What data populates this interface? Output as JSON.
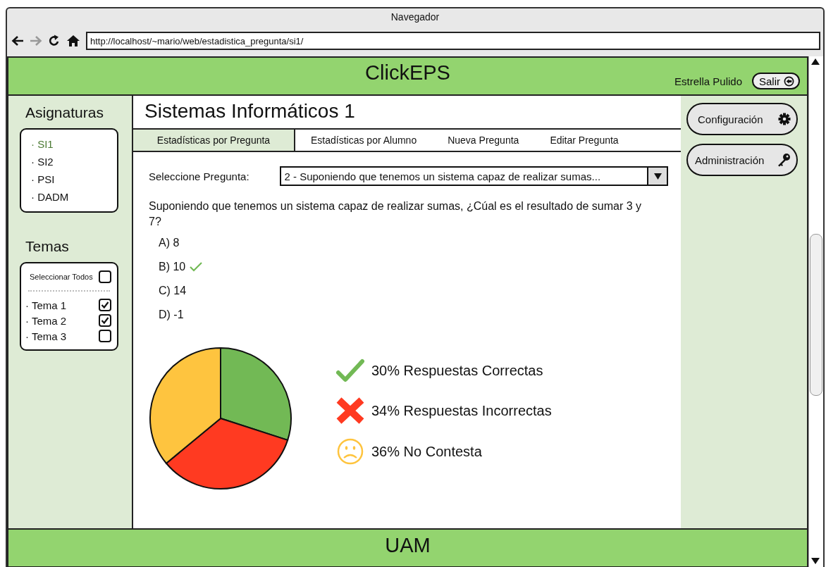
{
  "window": {
    "title": "Navegador"
  },
  "address_bar": {
    "url": "http://localhost/~mario/web/estadistica_pregunta/si1/"
  },
  "header": {
    "title": "ClickEPS",
    "user": "Estrella Pulido",
    "logout": "Salir"
  },
  "sidebar": {
    "subjects_title": "Asignaturas",
    "subjects": [
      {
        "label": "· SI1",
        "selected": true
      },
      {
        "label": "· SI2",
        "selected": false
      },
      {
        "label": "· PSI",
        "selected": false
      },
      {
        "label": "· DADM",
        "selected": false
      }
    ],
    "topics_title": "Temas",
    "select_all": {
      "label": "Seleccionar Todos",
      "checked": false
    },
    "topics": [
      {
        "label": "· Tema 1",
        "checked": true
      },
      {
        "label": "· Tema 2",
        "checked": true
      },
      {
        "label": "· Tema 3",
        "checked": false
      }
    ]
  },
  "page_title": "Sistemas Informáticos 1",
  "tabs": [
    {
      "label": "Estadísticas por Pregunta",
      "selected": true
    },
    {
      "label": "Estadísticas por Alumno",
      "selected": false
    },
    {
      "label": "Nueva Pregunta",
      "selected": false
    },
    {
      "label": "Editar Pregunta",
      "selected": false
    }
  ],
  "question_select": {
    "label": "Seleccione Pregunta:",
    "value": "2 - Suponiendo que tenemos un sistema capaz de realizar sumas..."
  },
  "question": "Suponiendo que tenemos un sistema capaz de realizar sumas, ¿Cúal es el resultado de sumar 3 y 7?",
  "options": [
    {
      "label": "A) 8",
      "correct": false
    },
    {
      "label": "B) 10",
      "correct": true
    },
    {
      "label": "C) 14",
      "correct": false
    },
    {
      "label": "D) -1",
      "correct": false
    }
  ],
  "chart_data": {
    "type": "pie",
    "values": [
      30,
      34,
      36
    ],
    "colors": [
      "#72b955",
      "#ff3a21",
      "#fec43f"
    ]
  },
  "legend": [
    {
      "kind": "check",
      "text": "30% Respuestas Correctas"
    },
    {
      "kind": "cross",
      "text": "34% Respuestas Incorrectas"
    },
    {
      "kind": "sad",
      "text": "36% No Contesta"
    }
  ],
  "right_panel": {
    "buttons": [
      {
        "kind": "gear",
        "label": "Configuración"
      },
      {
        "kind": "key",
        "label": "Administración"
      }
    ]
  },
  "footer": {
    "text": "UAM"
  }
}
